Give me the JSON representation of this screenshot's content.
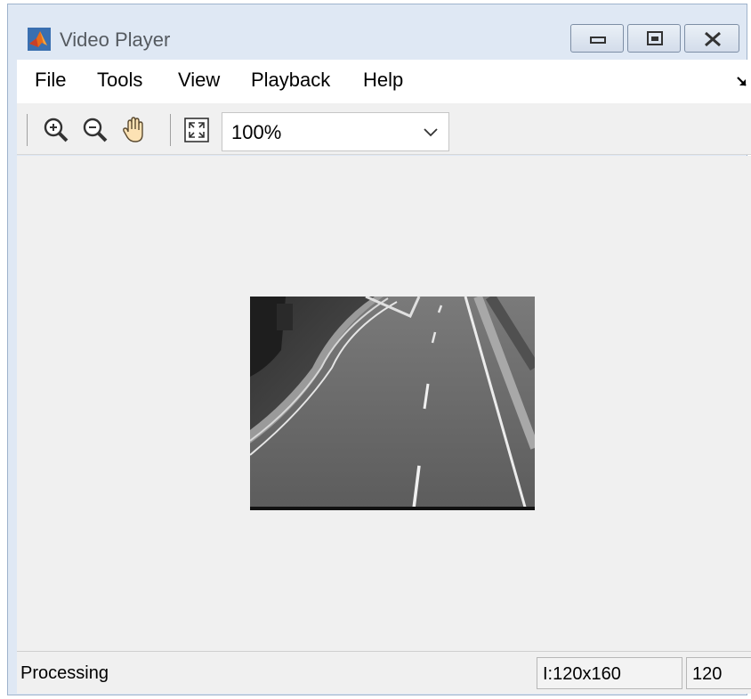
{
  "window": {
    "title": "Video Player",
    "app_icon": "matlab-logo-icon",
    "controls": [
      "minimize-icon",
      "maximize-icon",
      "close-icon"
    ]
  },
  "menu": {
    "items": [
      {
        "label": "File"
      },
      {
        "label": "Tools"
      },
      {
        "label": "View"
      },
      {
        "label": "Playback"
      },
      {
        "label": "Help"
      }
    ],
    "undock_icon": "undock-arrow-icon"
  },
  "toolbar": {
    "buttons": [
      "zoom-in-icon",
      "zoom-out-icon",
      "pan-hand-icon",
      "fit-to-window-icon"
    ],
    "zoom": {
      "value": "100%",
      "arrow_icon": "chevron-down-icon"
    }
  },
  "display": {
    "frame": "grayscale highway road frame"
  },
  "status": {
    "text": "Processing",
    "dims": "I:120x160",
    "frame_number": "120"
  },
  "colors": {
    "window_frame": "#dfe8f4",
    "panel_background": "#f0f0f0",
    "menubar": "#ffffff"
  }
}
